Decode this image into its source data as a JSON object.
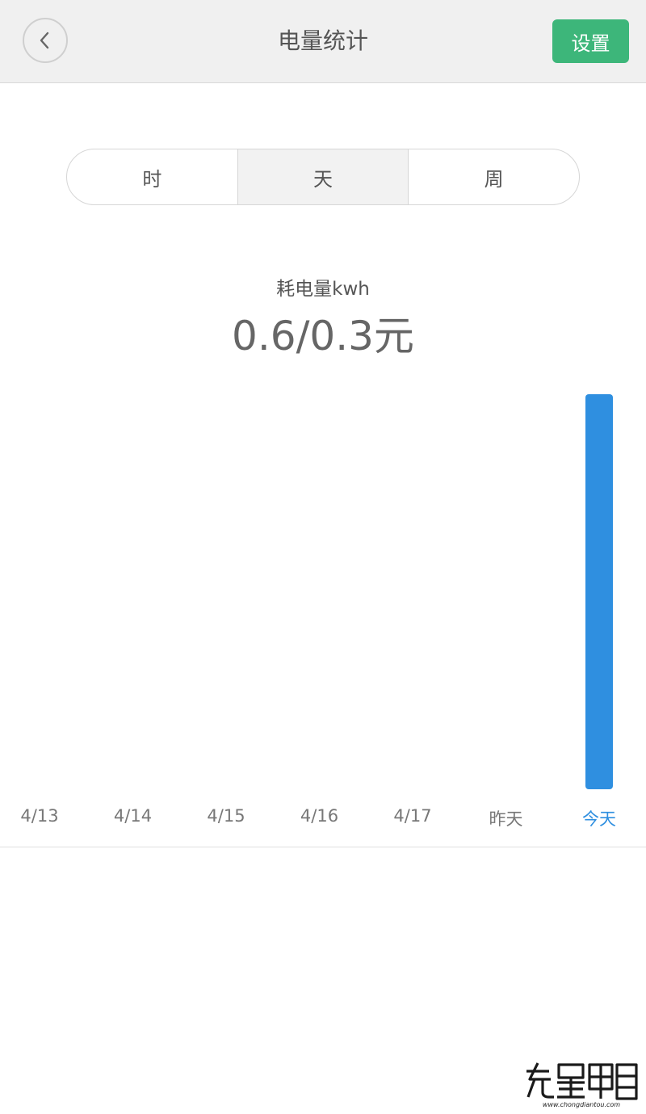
{
  "header": {
    "back_icon": "chevron-left-icon",
    "title": "电量统计",
    "settings_label": "设置"
  },
  "tabs": [
    {
      "label": "时",
      "active": false
    },
    {
      "label": "天",
      "active": true
    },
    {
      "label": "周",
      "active": false
    }
  ],
  "summary": {
    "label": "耗电量kwh",
    "value": "0.6/0.3元"
  },
  "colors": {
    "accent": "#2f8fe0",
    "settings_button": "#3db67a",
    "header_bg": "#f0f0f0"
  },
  "chart_data": {
    "type": "bar",
    "categories": [
      "4/13",
      "4/14",
      "4/15",
      "4/16",
      "4/17",
      "昨天",
      "今天"
    ],
    "values": [
      0,
      0,
      0,
      0,
      0,
      0,
      0.6
    ],
    "ylim": [
      0,
      0.6
    ],
    "selected_category": "今天",
    "grid": false
  },
  "watermark": {
    "text": "充电头网",
    "subtext": "www.chongdiantou.com"
  }
}
